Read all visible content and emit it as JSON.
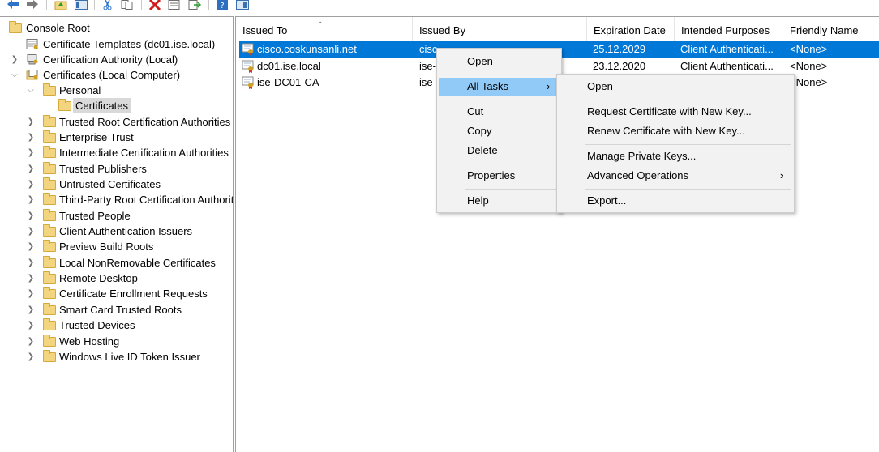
{
  "toolbar": {
    "buttons": [
      "back-icon",
      "forward-icon",
      "up-folder-icon",
      "show-hide-tree-icon",
      "cut-icon",
      "copy-icon",
      "delete-icon",
      "properties-icon",
      "export-list-icon",
      "help-icon",
      "action-pane-icon"
    ]
  },
  "tree": {
    "items": [
      {
        "label": "Console Root",
        "level": 0,
        "expanded": null
      },
      {
        "label": "Certificate Templates (dc01.ise.local)",
        "level": 1,
        "expanded": null
      },
      {
        "label": "Certification Authority (Local)",
        "level": 1,
        "expanded": false
      },
      {
        "label": "Certificates (Local Computer)",
        "level": 1,
        "expanded": true
      },
      {
        "label": "Personal",
        "level": 2,
        "expanded": true
      },
      {
        "label": "Certificates",
        "level": 3,
        "expanded": null,
        "selected": true
      },
      {
        "label": "Trusted Root Certification Authorities",
        "level": 2,
        "expanded": false
      },
      {
        "label": "Enterprise Trust",
        "level": 2,
        "expanded": false
      },
      {
        "label": "Intermediate Certification Authorities",
        "level": 2,
        "expanded": false
      },
      {
        "label": "Trusted Publishers",
        "level": 2,
        "expanded": false
      },
      {
        "label": "Untrusted Certificates",
        "level": 2,
        "expanded": false
      },
      {
        "label": "Third-Party Root Certification Authorities",
        "level": 2,
        "expanded": false
      },
      {
        "label": "Trusted People",
        "level": 2,
        "expanded": false
      },
      {
        "label": "Client Authentication Issuers",
        "level": 2,
        "expanded": false
      },
      {
        "label": "Preview Build Roots",
        "level": 2,
        "expanded": false
      },
      {
        "label": "Local NonRemovable Certificates",
        "level": 2,
        "expanded": false
      },
      {
        "label": "Remote Desktop",
        "level": 2,
        "expanded": false
      },
      {
        "label": "Certificate Enrollment Requests",
        "level": 2,
        "expanded": false
      },
      {
        "label": "Smart Card Trusted Roots",
        "level": 2,
        "expanded": false
      },
      {
        "label": "Trusted Devices",
        "level": 2,
        "expanded": false
      },
      {
        "label": "Web Hosting",
        "level": 2,
        "expanded": false
      },
      {
        "label": "Windows Live ID Token Issuer",
        "level": 2,
        "expanded": false
      }
    ]
  },
  "list": {
    "columns": [
      "Issued To",
      "Issued By",
      "Expiration Date",
      "Intended Purposes",
      "Friendly Name"
    ],
    "rows": [
      {
        "issued_to": "cisco.coskunsanli.net",
        "issued_by": "cisco.coskunsanli.net",
        "expiration": "25.12.2029",
        "purposes": "Client Authenticati...",
        "friendly": "<None>",
        "selected": true
      },
      {
        "issued_to": "dc01.ise.local",
        "issued_by": "ise-DC01-CA",
        "expiration": "23.12.2020",
        "purposes": "Client Authenticati...",
        "friendly": "<None>",
        "selected": false
      },
      {
        "issued_to": "ise-DC01-CA",
        "issued_by": "ise-DC01-CA",
        "expiration": "",
        "purposes": "",
        "friendly": "<None>",
        "selected": false
      }
    ]
  },
  "context_menu": {
    "open": "Open",
    "all_tasks": "All Tasks",
    "cut": "Cut",
    "copy": "Copy",
    "delete": "Delete",
    "properties": "Properties",
    "help": "Help"
  },
  "submenu": {
    "open": "Open",
    "request_new_key": "Request Certificate with New Key...",
    "renew_new_key": "Renew Certificate with New Key...",
    "manage_private_keys": "Manage Private Keys...",
    "advanced_operations": "Advanced Operations",
    "export": "Export..."
  },
  "colors": {
    "selection": "#0078d7",
    "menu_highlight": "#91c9f7",
    "menu_bg": "#f2f2f2",
    "tree_selected": "#d9d9d9"
  }
}
